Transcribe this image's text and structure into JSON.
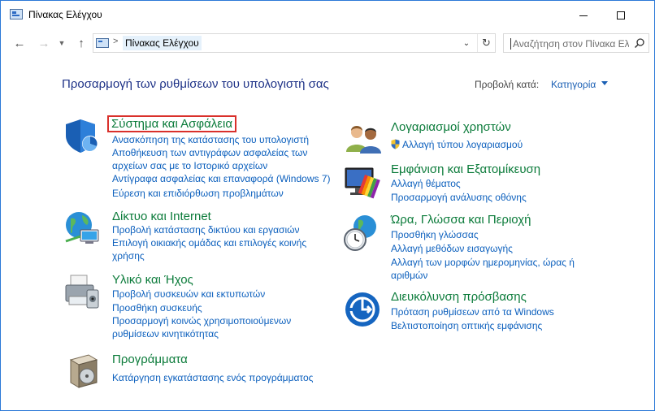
{
  "window": {
    "title": "Πίνακας Ελέγχου"
  },
  "address": {
    "crumb": "Πίνακας Ελέγχου",
    "separator": ">"
  },
  "search": {
    "placeholder": "Αναζήτηση στον Πίνακα Ελέγ..."
  },
  "header": {
    "heading": "Προσαρμογή των ρυθμίσεων του υπολογιστή σας",
    "viewby_label": "Προβολή κατά:",
    "viewby_value": "Κατηγορία"
  },
  "categories": {
    "system": {
      "title": "Σύστημα και Ασφάλεια",
      "links": [
        "Ανασκόπηση της κατάστασης του υπολογιστή",
        "Αποθήκευση των αντιγράφων ασφαλείας των",
        "αρχείων σας με το Ιστορικό αρχείων",
        "Αντίγραφα ασφαλείας και επαναφορά (Windows 7)",
        "Εύρεση και επιδιόρθωση προβλημάτων"
      ]
    },
    "network": {
      "title": "Δίκτυο και Internet",
      "links": [
        "Προβολή κατάστασης δικτύου και εργασιών",
        "Επιλογή οικιακής ομάδας και επιλογές κοινής",
        "χρήσης"
      ]
    },
    "hardware": {
      "title": "Υλικό και Ήχος",
      "links": [
        "Προβολή συσκευών και εκτυπωτών",
        "Προσθήκη συσκευής",
        "Προσαρμογή κοινώς χρησιμοποιούμενων",
        "ρυθμίσεων κινητικότητας"
      ]
    },
    "programs": {
      "title": "Προγράμματα",
      "links": [
        "Κατάργηση εγκατάστασης ενός προγράμματος"
      ]
    },
    "accounts": {
      "title": "Λογαριασμοί χρηστών",
      "links": [
        "Αλλαγή τύπου λογαριασμού"
      ]
    },
    "appearance": {
      "title": "Εμφάνιση και Εξατομίκευση",
      "links": [
        "Αλλαγή θέματος",
        "Προσαρμογή ανάλυσης οθόνης"
      ]
    },
    "clock": {
      "title": "Ώρα, Γλώσσα και Περιοχή",
      "links": [
        "Προσθήκη γλώσσας",
        "Αλλαγή μεθόδων εισαγωγής",
        "Αλλαγή των μορφών ημερομηνίας, ώρας ή",
        "αριθμών"
      ]
    },
    "ease": {
      "title": "Διευκόλυνση πρόσβασης",
      "links": [
        "Πρόταση ρυθμίσεων από τα Windows",
        "Βελτιστοποίηση οπτικής εμφάνισης"
      ]
    }
  },
  "colors": {
    "category_title": "#0b7b3a",
    "link": "#0b5fbd",
    "heading": "#1e3287",
    "highlight_border": "#d9302b",
    "window_border": "#2b79d7"
  }
}
